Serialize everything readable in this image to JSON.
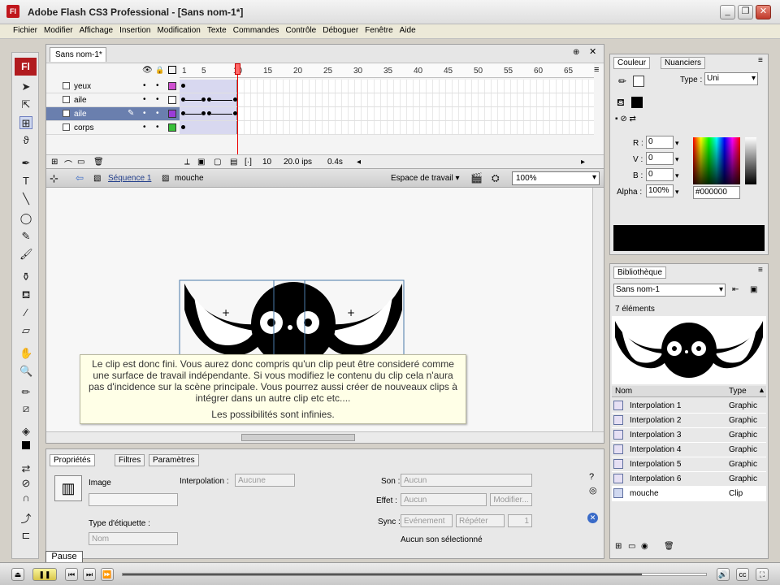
{
  "window": {
    "title": "Adobe Flash CS3 Professional - [Sans nom-1*]",
    "app_logo": "Fl"
  },
  "menu": [
    "Fichier",
    "Modifier",
    "Affichage",
    "Insertion",
    "Modification",
    "Texte",
    "Commandes",
    "Contrôle",
    "Déboguer",
    "Fenêtre",
    "Aide"
  ],
  "document": {
    "tab": "Sans nom-1*"
  },
  "timeline": {
    "ruler": [
      "1",
      "5",
      "10",
      "15",
      "20",
      "25",
      "30",
      "35",
      "40",
      "45",
      "50",
      "55",
      "60",
      "65"
    ],
    "layers": [
      {
        "name": "yeux",
        "color": "#d050d0",
        "selected": false
      },
      {
        "name": "aile",
        "color": "#ffffff",
        "selected": false
      },
      {
        "name": "aile",
        "color": "#9a3cd8",
        "selected": true
      },
      {
        "name": "corps",
        "color": "#38c038",
        "selected": false
      }
    ],
    "status": {
      "frame": "10",
      "fps": "20.0 ips",
      "time": "0.4s"
    }
  },
  "editbar": {
    "scene": "Séquence 1",
    "symbol": "mouche",
    "workspace": "Espace de travail ▾",
    "zoom": "100%"
  },
  "tooltip": {
    "text": "Le clip est donc fini. Vous aurez donc compris qu'un clip peut être consideré comme une surface de travail indépendante. Si vous modifiez le contenu du clip cela n'aura pas d'incidence sur la scène principale. Vous pourrez aussi créer de nouveaux clips à intégrer dans un autre clip etc etc....",
    "footer": "Les possibilités sont infinies."
  },
  "properties": {
    "tabs": [
      "Propriétés",
      "Filtres",
      "Paramètres"
    ],
    "image_label": "Image",
    "label_type": "Type d'étiquette :",
    "label_type_value": "Nom",
    "interpolation_label": "Interpolation :",
    "interpolation_value": "Aucune",
    "son_label": "Son :",
    "son_value": "Aucun",
    "effet_label": "Effet :",
    "effet_value": "Aucun",
    "modifier_button": "Modifier...",
    "sync_label": "Sync :",
    "sync_value": "Evénement",
    "repeat_value": "Répéter",
    "repeat_count": "1",
    "no_sound": "Aucun son sélectionné"
  },
  "color_panel": {
    "tabs": [
      "Couleur",
      "Nuanciers"
    ],
    "type_label": "Type :",
    "type_value": "Uni",
    "r_label": "R :",
    "r": "0",
    "v_label": "V :",
    "v": "0",
    "b_label": "B :",
    "b": "0",
    "alpha_label": "Alpha :",
    "alpha": "100%",
    "hex": "#000000",
    "swatch_color": "#000000"
  },
  "library": {
    "tab": "Bibliothèque",
    "doc": "Sans nom-1",
    "count": "7 éléments",
    "col_name": "Nom",
    "col_type": "Type",
    "items": [
      {
        "name": "Interpolation 1",
        "type": "Graphic"
      },
      {
        "name": "Interpolation 2",
        "type": "Graphic"
      },
      {
        "name": "Interpolation 3",
        "type": "Graphic"
      },
      {
        "name": "Interpolation 4",
        "type": "Graphic"
      },
      {
        "name": "Interpolation 5",
        "type": "Graphic"
      },
      {
        "name": "Interpolation 6",
        "type": "Graphic"
      },
      {
        "name": "mouche",
        "type": "Clip"
      }
    ]
  },
  "player": {
    "pause_tooltip": "Pause",
    "progress": 0.89
  }
}
